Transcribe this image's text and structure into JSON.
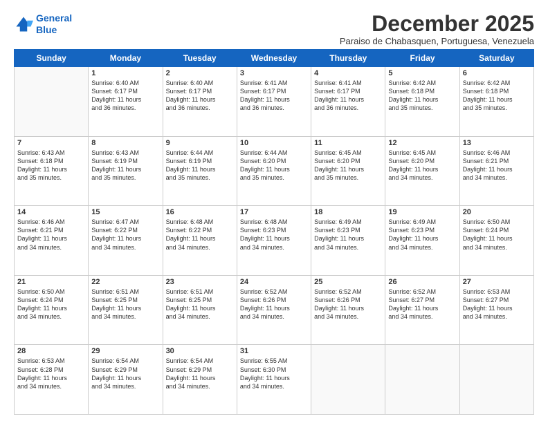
{
  "header": {
    "logo_line1": "General",
    "logo_line2": "Blue",
    "month": "December 2025",
    "location": "Paraiso de Chabasquen, Portuguesa, Venezuela"
  },
  "days_of_week": [
    "Sunday",
    "Monday",
    "Tuesday",
    "Wednesday",
    "Thursday",
    "Friday",
    "Saturday"
  ],
  "weeks": [
    [
      {
        "day": "",
        "info": ""
      },
      {
        "day": "1",
        "info": "Sunrise: 6:40 AM\nSunset: 6:17 PM\nDaylight: 11 hours\nand 36 minutes."
      },
      {
        "day": "2",
        "info": "Sunrise: 6:40 AM\nSunset: 6:17 PM\nDaylight: 11 hours\nand 36 minutes."
      },
      {
        "day": "3",
        "info": "Sunrise: 6:41 AM\nSunset: 6:17 PM\nDaylight: 11 hours\nand 36 minutes."
      },
      {
        "day": "4",
        "info": "Sunrise: 6:41 AM\nSunset: 6:17 PM\nDaylight: 11 hours\nand 36 minutes."
      },
      {
        "day": "5",
        "info": "Sunrise: 6:42 AM\nSunset: 6:18 PM\nDaylight: 11 hours\nand 35 minutes."
      },
      {
        "day": "6",
        "info": "Sunrise: 6:42 AM\nSunset: 6:18 PM\nDaylight: 11 hours\nand 35 minutes."
      }
    ],
    [
      {
        "day": "7",
        "info": "Sunrise: 6:43 AM\nSunset: 6:18 PM\nDaylight: 11 hours\nand 35 minutes."
      },
      {
        "day": "8",
        "info": "Sunrise: 6:43 AM\nSunset: 6:19 PM\nDaylight: 11 hours\nand 35 minutes."
      },
      {
        "day": "9",
        "info": "Sunrise: 6:44 AM\nSunset: 6:19 PM\nDaylight: 11 hours\nand 35 minutes."
      },
      {
        "day": "10",
        "info": "Sunrise: 6:44 AM\nSunset: 6:20 PM\nDaylight: 11 hours\nand 35 minutes."
      },
      {
        "day": "11",
        "info": "Sunrise: 6:45 AM\nSunset: 6:20 PM\nDaylight: 11 hours\nand 35 minutes."
      },
      {
        "day": "12",
        "info": "Sunrise: 6:45 AM\nSunset: 6:20 PM\nDaylight: 11 hours\nand 34 minutes."
      },
      {
        "day": "13",
        "info": "Sunrise: 6:46 AM\nSunset: 6:21 PM\nDaylight: 11 hours\nand 34 minutes."
      }
    ],
    [
      {
        "day": "14",
        "info": "Sunrise: 6:46 AM\nSunset: 6:21 PM\nDaylight: 11 hours\nand 34 minutes."
      },
      {
        "day": "15",
        "info": "Sunrise: 6:47 AM\nSunset: 6:22 PM\nDaylight: 11 hours\nand 34 minutes."
      },
      {
        "day": "16",
        "info": "Sunrise: 6:48 AM\nSunset: 6:22 PM\nDaylight: 11 hours\nand 34 minutes."
      },
      {
        "day": "17",
        "info": "Sunrise: 6:48 AM\nSunset: 6:23 PM\nDaylight: 11 hours\nand 34 minutes."
      },
      {
        "day": "18",
        "info": "Sunrise: 6:49 AM\nSunset: 6:23 PM\nDaylight: 11 hours\nand 34 minutes."
      },
      {
        "day": "19",
        "info": "Sunrise: 6:49 AM\nSunset: 6:23 PM\nDaylight: 11 hours\nand 34 minutes."
      },
      {
        "day": "20",
        "info": "Sunrise: 6:50 AM\nSunset: 6:24 PM\nDaylight: 11 hours\nand 34 minutes."
      }
    ],
    [
      {
        "day": "21",
        "info": "Sunrise: 6:50 AM\nSunset: 6:24 PM\nDaylight: 11 hours\nand 34 minutes."
      },
      {
        "day": "22",
        "info": "Sunrise: 6:51 AM\nSunset: 6:25 PM\nDaylight: 11 hours\nand 34 minutes."
      },
      {
        "day": "23",
        "info": "Sunrise: 6:51 AM\nSunset: 6:25 PM\nDaylight: 11 hours\nand 34 minutes."
      },
      {
        "day": "24",
        "info": "Sunrise: 6:52 AM\nSunset: 6:26 PM\nDaylight: 11 hours\nand 34 minutes."
      },
      {
        "day": "25",
        "info": "Sunrise: 6:52 AM\nSunset: 6:26 PM\nDaylight: 11 hours\nand 34 minutes."
      },
      {
        "day": "26",
        "info": "Sunrise: 6:52 AM\nSunset: 6:27 PM\nDaylight: 11 hours\nand 34 minutes."
      },
      {
        "day": "27",
        "info": "Sunrise: 6:53 AM\nSunset: 6:27 PM\nDaylight: 11 hours\nand 34 minutes."
      }
    ],
    [
      {
        "day": "28",
        "info": "Sunrise: 6:53 AM\nSunset: 6:28 PM\nDaylight: 11 hours\nand 34 minutes."
      },
      {
        "day": "29",
        "info": "Sunrise: 6:54 AM\nSunset: 6:29 PM\nDaylight: 11 hours\nand 34 minutes."
      },
      {
        "day": "30",
        "info": "Sunrise: 6:54 AM\nSunset: 6:29 PM\nDaylight: 11 hours\nand 34 minutes."
      },
      {
        "day": "31",
        "info": "Sunrise: 6:55 AM\nSunset: 6:30 PM\nDaylight: 11 hours\nand 34 minutes."
      },
      {
        "day": "",
        "info": ""
      },
      {
        "day": "",
        "info": ""
      },
      {
        "day": "",
        "info": ""
      }
    ]
  ]
}
